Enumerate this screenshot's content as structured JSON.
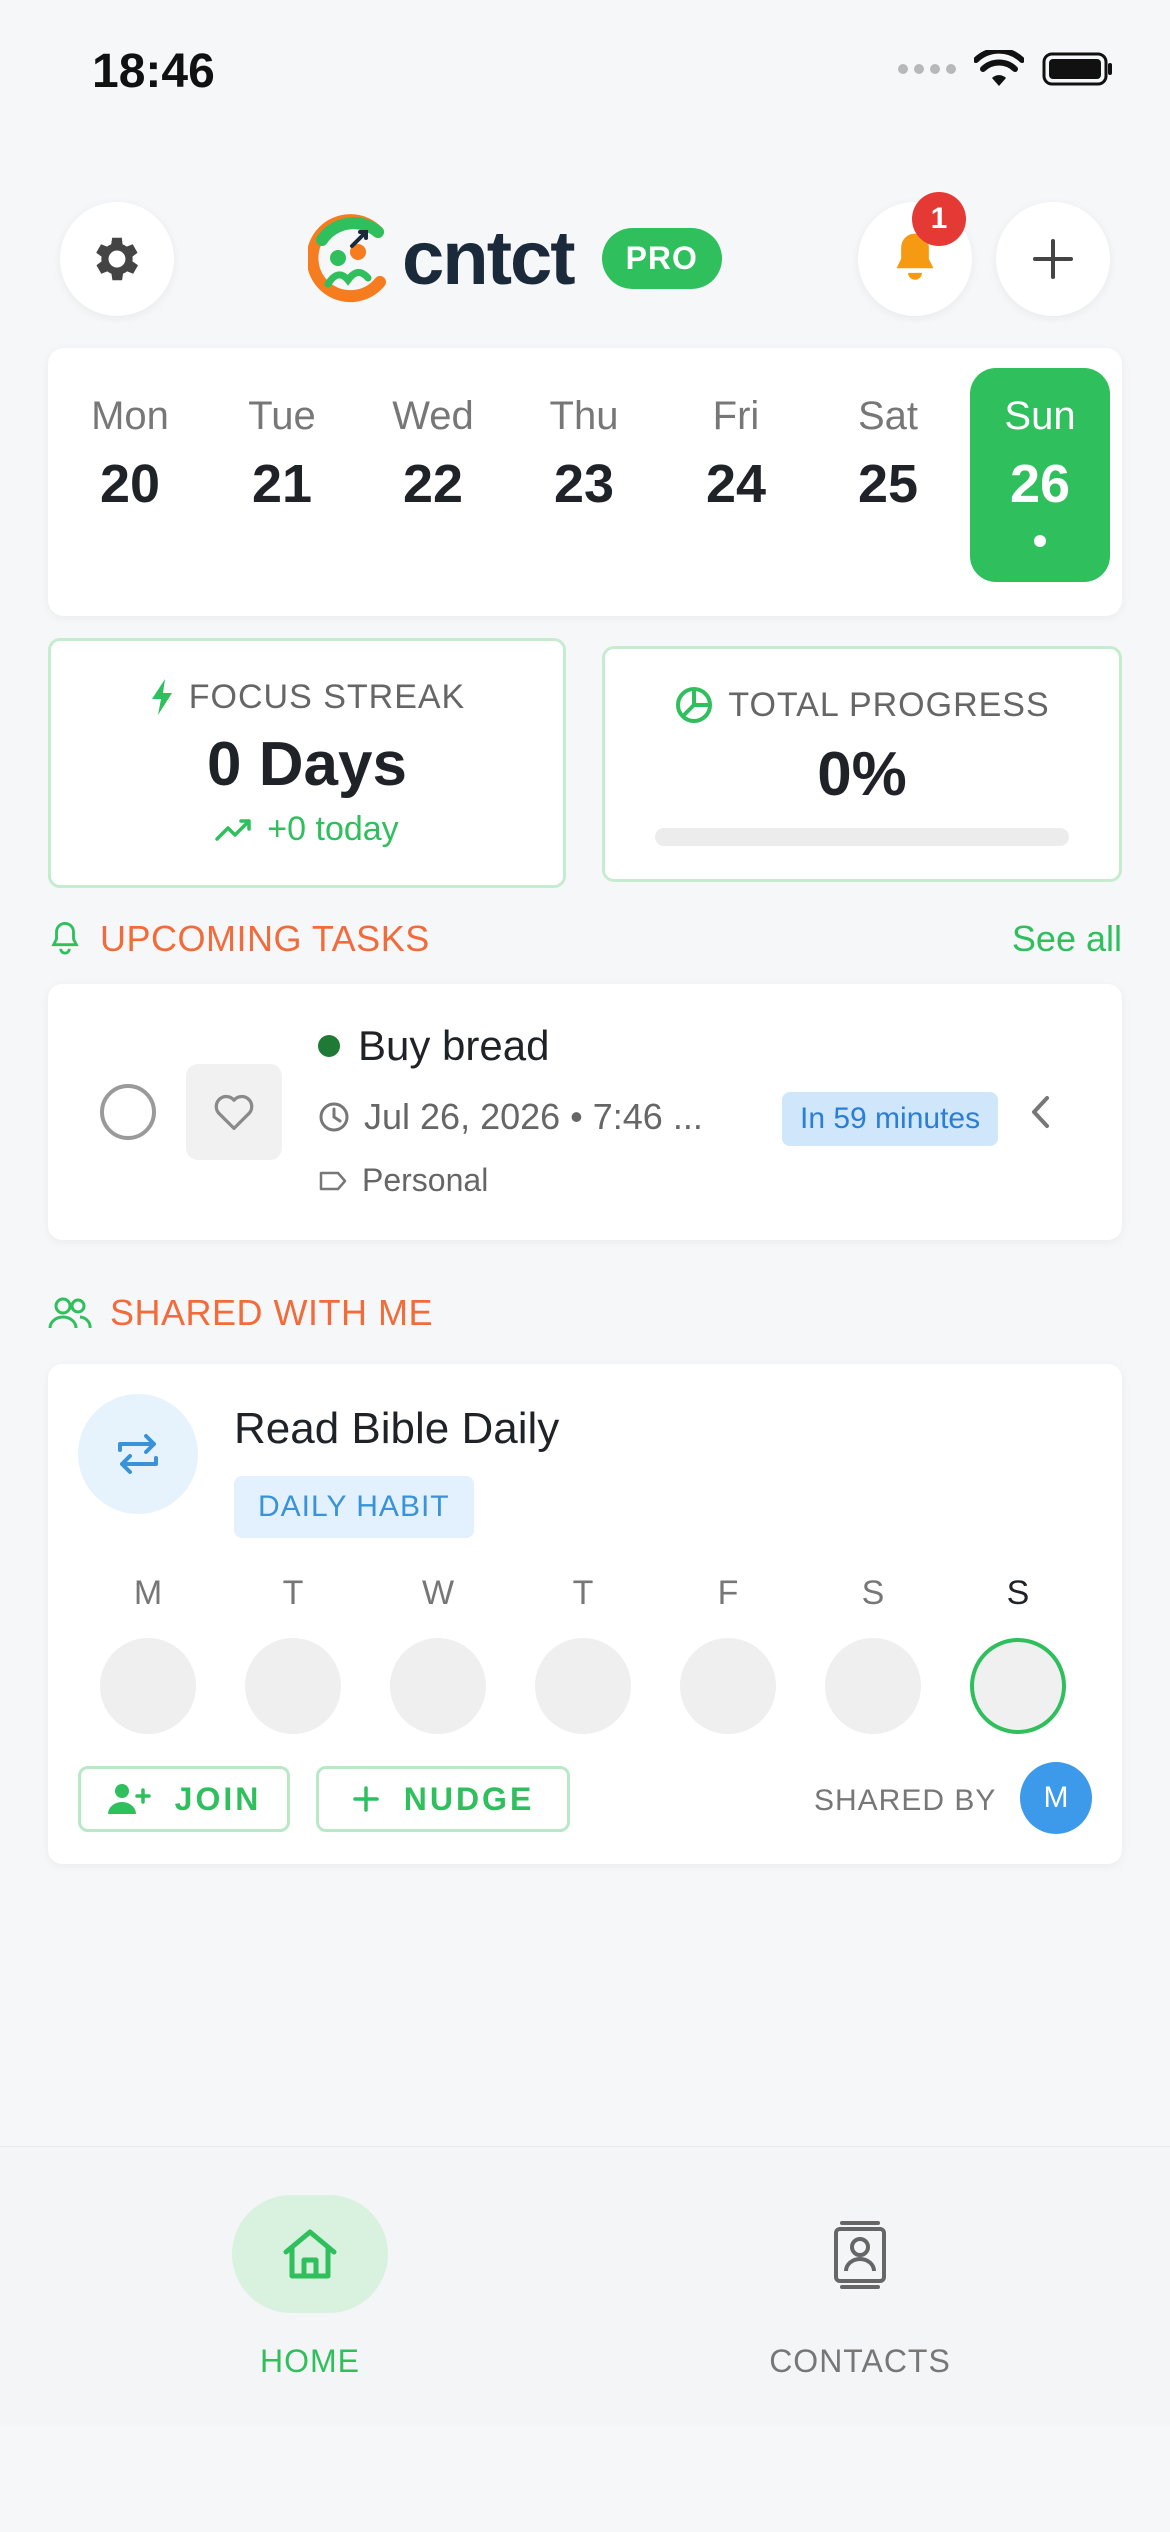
{
  "status": {
    "time": "18:46"
  },
  "header": {
    "brand": "cntct",
    "badge": "PRO",
    "notification_count": "1",
    "icons": [
      "gear-icon",
      "bell-icon",
      "plus-icon"
    ]
  },
  "calendar": {
    "days": [
      {
        "name": "Mon",
        "num": "20"
      },
      {
        "name": "Tue",
        "num": "21"
      },
      {
        "name": "Wed",
        "num": "22"
      },
      {
        "name": "Thu",
        "num": "23"
      },
      {
        "name": "Fri",
        "num": "24"
      },
      {
        "name": "Sat",
        "num": "25"
      },
      {
        "name": "Sun",
        "num": "26"
      }
    ],
    "selected": "Sun"
  },
  "focus_streak": {
    "title": "FOCUS STREAK",
    "value": "0 Days",
    "sub": "+0 today"
  },
  "total_progress": {
    "title": "TOTAL PROGRESS",
    "value": "0%",
    "fraction": 0
  },
  "upcoming": {
    "title": "UPCOMING TASKS",
    "see_all": "See all",
    "task": {
      "title": "Buy bread",
      "time": "Jul 26, 2026 • 7:46 ...",
      "tag": "Personal",
      "chip": "In 59 minutes"
    }
  },
  "shared": {
    "title": "SHARED WITH ME",
    "habit": {
      "title": "Read Bible Daily",
      "chip": "DAILY HABIT",
      "week": [
        "M",
        "T",
        "W",
        "T",
        "F",
        "S",
        "S"
      ],
      "today_index": 6,
      "join": "JOIN",
      "nudge": "NUDGE",
      "shared_by": "SHARED BY",
      "avatar": "M"
    }
  },
  "nav": {
    "home": "HOME",
    "contacts": "CONTACTS"
  },
  "colors": {
    "accent": "#2fbf5d",
    "section": "#f26b3a",
    "info": "#2a7fd4"
  }
}
